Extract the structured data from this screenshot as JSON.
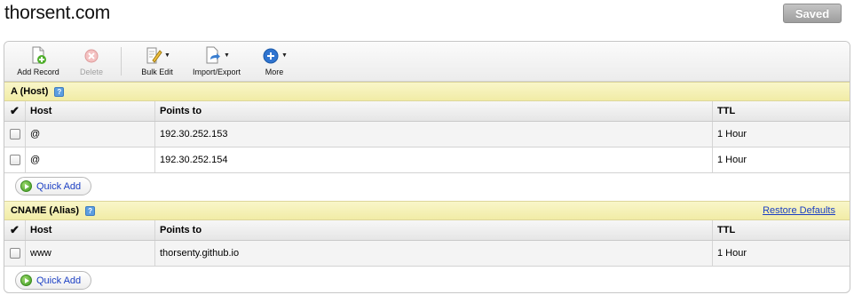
{
  "header": {
    "title": "thorsent.com",
    "saved_label": "Saved"
  },
  "toolbar": {
    "add_record": "Add Record",
    "delete": "Delete",
    "bulk_edit": "Bulk Edit",
    "import_export": "Import/Export",
    "more": "More"
  },
  "sections": [
    {
      "title": "A (Host)",
      "columns": {
        "host": "Host",
        "points_to": "Points to",
        "ttl": "TTL"
      },
      "rows": [
        {
          "host": "@",
          "points_to": "192.30.252.153",
          "ttl": "1 Hour"
        },
        {
          "host": "@",
          "points_to": "192.30.252.154",
          "ttl": "1 Hour"
        }
      ],
      "quick_add": "Quick Add"
    },
    {
      "title": "CNAME (Alias)",
      "restore_defaults": "Restore Defaults",
      "columns": {
        "host": "Host",
        "points_to": "Points to",
        "ttl": "TTL"
      },
      "rows": [
        {
          "host": "www",
          "points_to": "thorsenty.github.io",
          "ttl": "1 Hour"
        }
      ],
      "quick_add": "Quick Add"
    }
  ],
  "colors": {
    "link": "#1b3fc4",
    "section_header": "#f4efb4",
    "saved_button": "#b0b0b0"
  }
}
